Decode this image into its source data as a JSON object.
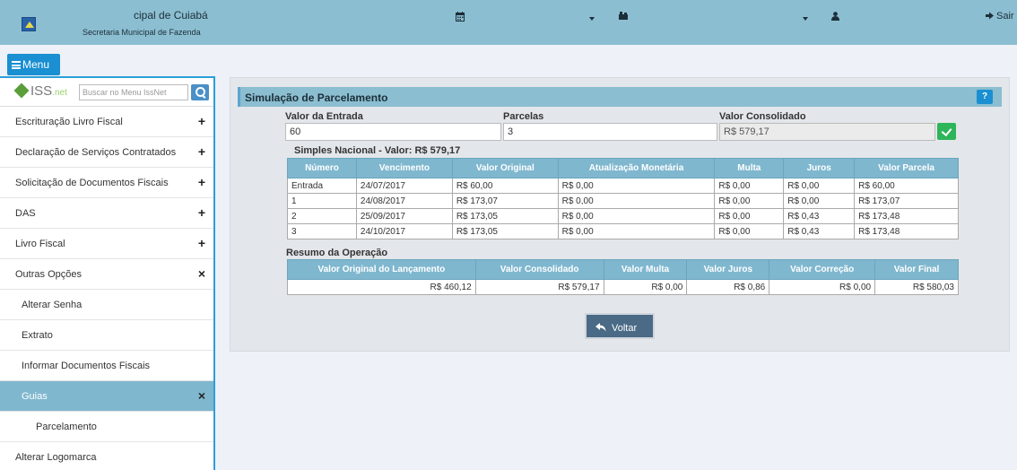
{
  "header": {
    "title": "cipal de Cuiabá",
    "subtitle": "Secretaria Municipal de Fazenda",
    "calendar_icon": "calendar-icon",
    "user_icon": "user-icon",
    "logout_label": "Sair"
  },
  "menu_button": {
    "label": "Menu"
  },
  "sidebar": {
    "logo_text": "ISS",
    "logo_suffix": ".net",
    "search_placeholder": "Buscar no Menu IssNet",
    "items": [
      {
        "label": "Escrituração Livro Fiscal",
        "sign": "+"
      },
      {
        "label": "Declaração de Serviços Contratados",
        "sign": "+"
      },
      {
        "label": "Solicitação de Documentos Fiscais",
        "sign": "+"
      },
      {
        "label": "DAS",
        "sign": "+"
      },
      {
        "label": "Livro Fiscal",
        "sign": "+"
      },
      {
        "label": "Outras Opções",
        "sign": "×"
      },
      {
        "label": "Alterar Senha"
      },
      {
        "label": "Extrato"
      },
      {
        "label": "Informar Documentos Fiscais"
      },
      {
        "label": "Guias",
        "sign": "×"
      },
      {
        "label": "Parcelamento"
      },
      {
        "label": "Alterar Logomarca"
      }
    ]
  },
  "panel": {
    "title": "Simulação de Parcelamento",
    "help_label": "?",
    "fields": {
      "entrada_label": "Valor da Entrada",
      "entrada_value": "60",
      "parcelas_label": "Parcelas",
      "parcelas_value": "3",
      "consolidado_label": "Valor Consolidado",
      "consolidado_value": "R$ 579,17"
    },
    "simples_title": "Simples Nacional - Valor: R$ 579,17",
    "installments_table": {
      "headers": [
        "Número",
        "Vencimento",
        "Valor Original",
        "Atualização Monetária",
        "Multa",
        "Juros",
        "Valor Parcela"
      ],
      "rows": [
        [
          "Entrada",
          "24/07/2017",
          "R$ 60,00",
          "R$ 0,00",
          "R$ 0,00",
          "R$ 0,00",
          "R$ 60,00"
        ],
        [
          "1",
          "24/08/2017",
          "R$ 173,07",
          "R$ 0,00",
          "R$ 0,00",
          "R$ 0,00",
          "R$ 173,07"
        ],
        [
          "2",
          "25/09/2017",
          "R$ 173,05",
          "R$ 0,00",
          "R$ 0,00",
          "R$ 0,43",
          "R$ 173,48"
        ],
        [
          "3",
          "24/10/2017",
          "R$ 173,05",
          "R$ 0,00",
          "R$ 0,00",
          "R$ 0,43",
          "R$ 173,48"
        ]
      ]
    },
    "resumo_title": "Resumo da Operação",
    "summary_table": {
      "headers": [
        "Valor Original do Lançamento",
        "Valor Consolidado",
        "Valor Multa",
        "Valor Juros",
        "Valor Correção",
        "Valor Final"
      ],
      "row": [
        "R$ 460,12",
        "R$ 579,17",
        "R$ 0,00",
        "R$ 0,86",
        "R$ 0,00",
        "R$ 580,03"
      ]
    },
    "back_button": "Voltar"
  }
}
